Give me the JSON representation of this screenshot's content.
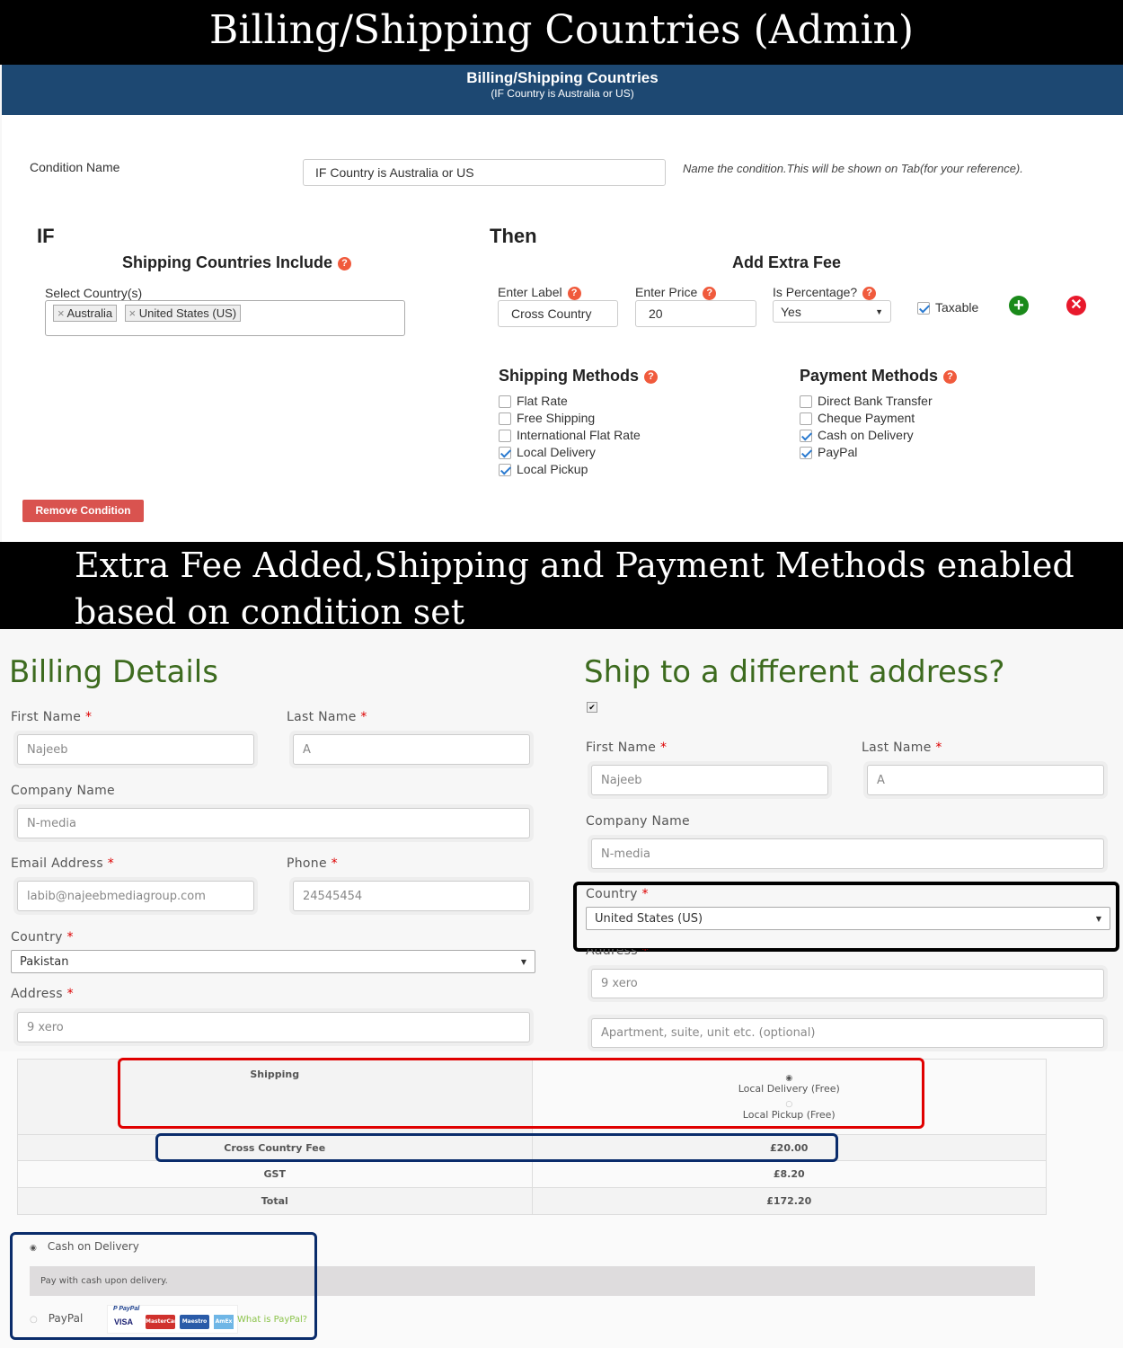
{
  "top_banner": "Billing/Shipping Countries (Admin)",
  "admin": {
    "header_title": "Billing/Shipping Countries",
    "header_subtitle": "(IF Country is Australia or US)",
    "condition_name_label": "Condition Name",
    "condition_name_value": "IF Country is Australia or US",
    "condition_name_hint": "Name the condition.This will be shown on Tab(for your reference).",
    "if_heading": "IF",
    "then_heading": "Then",
    "shipping_countries_include": "Shipping Countries Include",
    "select_countries_label": "Select Country(s)",
    "selected_countries": [
      "Australia",
      "United States (US)"
    ],
    "add_extra_fee": "Add Extra Fee",
    "enter_label": "Enter Label",
    "label_value": "Cross Country",
    "enter_price": "Enter Price",
    "price_value": "20",
    "is_percentage": "Is Percentage?",
    "percentage_value": "Yes",
    "taxable_label": "Taxable",
    "taxable_checked": true,
    "shipping_methods_heading": "Shipping Methods",
    "shipping_methods": [
      {
        "label": "Flat Rate",
        "checked": false
      },
      {
        "label": "Free Shipping",
        "checked": false
      },
      {
        "label": "International Flat Rate",
        "checked": false
      },
      {
        "label": "Local Delivery",
        "checked": true
      },
      {
        "label": "Local Pickup",
        "checked": true
      }
    ],
    "payment_methods_heading": "Payment Methods",
    "payment_methods": [
      {
        "label": "Direct Bank Transfer",
        "checked": false
      },
      {
        "label": "Cheque Payment",
        "checked": false
      },
      {
        "label": "Cash on Delivery",
        "checked": true
      },
      {
        "label": "PayPal",
        "checked": true
      }
    ],
    "remove_condition": "Remove Condition"
  },
  "mid_banner": [
    "Extra Fee Added,Shipping and Payment Methods enabled",
    "based on condition set"
  ],
  "billing": {
    "title": "Billing Details",
    "first_name_label": "First Name",
    "first_name": "Najeeb",
    "last_name_label": "Last Name",
    "last_name": "A",
    "company_label": "Company Name",
    "company": "N-media",
    "email_label": "Email Address",
    "email": "labib@najeebmediagroup.com",
    "phone_label": "Phone",
    "phone": "24545454",
    "country_label": "Country",
    "country": "Pakistan",
    "address_label": "Address",
    "address": "9 xero"
  },
  "shipping": {
    "title": "Ship to a different address?",
    "first_name_label": "First Name",
    "first_name": "Najeeb",
    "last_name_label": "Last Name",
    "last_name": "A",
    "company_label": "Company Name",
    "company": "N-media",
    "country_label": "Country",
    "country": "United States (US)",
    "address_label": "Address",
    "address": "9 xero",
    "address2_placeholder": "Apartment, suite, unit etc. (optional)"
  },
  "order": {
    "shipping_label": "Shipping",
    "shipping_options": [
      "Local Delivery (Free)",
      "Local Pickup (Free)"
    ],
    "rows": [
      {
        "label": "Cross Country Fee",
        "value": "£20.00"
      },
      {
        "label": "GST",
        "value": "£8.20"
      },
      {
        "label": "Total",
        "value": "£172.20"
      }
    ]
  },
  "payment": {
    "cod_label": "Cash on Delivery",
    "cod_desc": "Pay with cash upon delivery.",
    "paypal_label": "PayPal",
    "paypal_link": "What is PayPal?",
    "card_logos": [
      "PayPal",
      "VISA",
      "MasterCard",
      "Maestro",
      "AmEx"
    ]
  },
  "colors": {
    "header_blue": "#1d4872",
    "remove_red": "#d9534f",
    "highlight_red": "#e00000",
    "highlight_navy": "#0a2c6b",
    "green_heading": "#3d6b1f"
  }
}
